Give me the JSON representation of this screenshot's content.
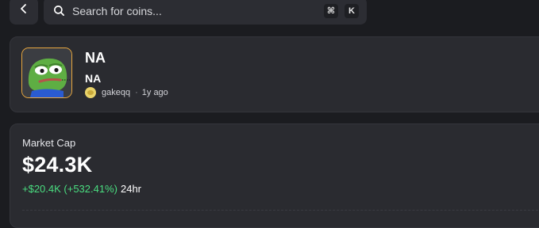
{
  "search": {
    "placeholder": "Search for coins...",
    "shortcut_modifier": "⌘",
    "shortcut_key": "K"
  },
  "token": {
    "name": "NA",
    "ticker": "NA",
    "creator": "gakeqq",
    "age": "1y ago",
    "separator": "·"
  },
  "market_cap": {
    "label": "Market Cap",
    "value": "$24.3K",
    "change": "+$20.4K (+532.41%)",
    "period": "24hr"
  },
  "colors": {
    "background": "#1b1c20",
    "card": "#2a2b30",
    "positive": "#4ade80",
    "avatar_border": "#e8a73f"
  },
  "icons": {
    "back": "chevron-left-icon",
    "search": "search-icon"
  }
}
